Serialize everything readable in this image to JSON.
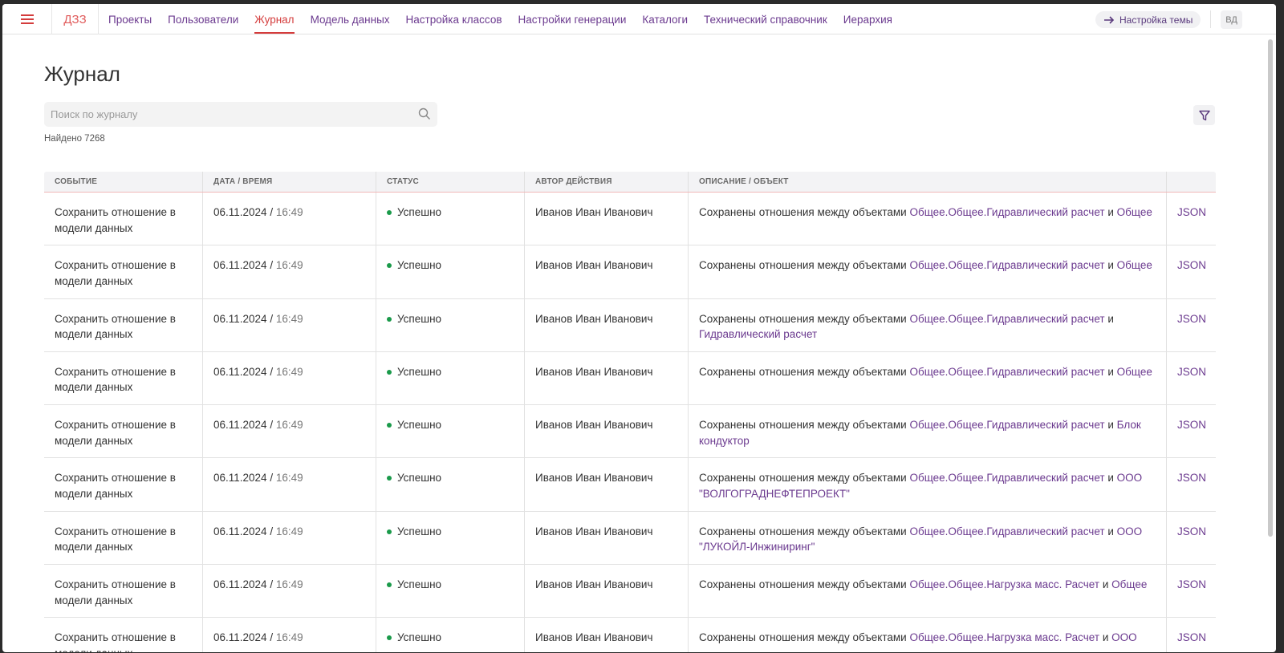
{
  "header": {
    "brand": "ДЗЗ",
    "nav": [
      {
        "label": "Проекты",
        "active": false
      },
      {
        "label": "Пользователи",
        "active": false
      },
      {
        "label": "Журнал",
        "active": true
      },
      {
        "label": "Модель данных",
        "active": false
      },
      {
        "label": "Настройка классов",
        "active": false
      },
      {
        "label": "Настройки генерации",
        "active": false
      },
      {
        "label": "Каталоги",
        "active": false
      },
      {
        "label": "Технический справочник",
        "active": false
      },
      {
        "label": "Иерархия",
        "active": false
      }
    ],
    "theme_button": "Настройка темы",
    "avatar": "ВД"
  },
  "page": {
    "title": "Журнал",
    "search_placeholder": "Поиск по журналу",
    "found": "Найдено 7268"
  },
  "table": {
    "columns": [
      "Событие",
      "Дата / время",
      "Статус",
      "Автор действия",
      "Описание / объект",
      ""
    ],
    "rows": [
      {
        "event": "Сохранить отношение в модели данных",
        "date": "06.11.2024",
        "time": "16:49",
        "status": "Успешно",
        "author": "Иванов Иван Иванович",
        "desc_prefix": "Сохранены отношения между объектами",
        "obj1": "Общее.Общее.Гидравлический расчет",
        "conj": "и",
        "obj2": "Общее",
        "action": "JSON"
      },
      {
        "event": "Сохранить отношение в модели данных",
        "date": "06.11.2024",
        "time": "16:49",
        "status": "Успешно",
        "author": "Иванов Иван Иванович",
        "desc_prefix": "Сохранены отношения между объектами",
        "obj1": "Общее.Общее.Гидравлический расчет",
        "conj": "и",
        "obj2": "Общее",
        "action": "JSON"
      },
      {
        "event": "Сохранить отношение в модели данных",
        "date": "06.11.2024",
        "time": "16:49",
        "status": "Успешно",
        "author": "Иванов Иван Иванович",
        "desc_prefix": "Сохранены отношения между объектами",
        "obj1": "Общее.Общее.Гидравлический расчет",
        "conj": "и",
        "obj2": "Гидравлический расчет",
        "action": "JSON"
      },
      {
        "event": "Сохранить отношение в модели данных",
        "date": "06.11.2024",
        "time": "16:49",
        "status": "Успешно",
        "author": "Иванов Иван Иванович",
        "desc_prefix": "Сохранены отношения между объектами",
        "obj1": "Общее.Общее.Гидравлический расчет",
        "conj": "и",
        "obj2": "Общее",
        "action": "JSON"
      },
      {
        "event": "Сохранить отношение в модели данных",
        "date": "06.11.2024",
        "time": "16:49",
        "status": "Успешно",
        "author": "Иванов Иван Иванович",
        "desc_prefix": "Сохранены отношения между объектами",
        "obj1": "Общее.Общее.Гидравлический расчет",
        "conj": "и",
        "obj2": "Блок кондуктор",
        "action": "JSON"
      },
      {
        "event": "Сохранить отношение в модели данных",
        "date": "06.11.2024",
        "time": "16:49",
        "status": "Успешно",
        "author": "Иванов Иван Иванович",
        "desc_prefix": "Сохранены отношения между объектами",
        "obj1": "Общее.Общее.Гидравлический расчет",
        "conj": "и",
        "obj2": "ООО \"ВОЛГОГРАДНЕФТЕПРОЕКТ\"",
        "action": "JSON"
      },
      {
        "event": "Сохранить отношение в модели данных",
        "date": "06.11.2024",
        "time": "16:49",
        "status": "Успешно",
        "author": "Иванов Иван Иванович",
        "desc_prefix": "Сохранены отношения между объектами",
        "obj1": "Общее.Общее.Гидравлический расчет",
        "conj": "и",
        "obj2": "ООО \"ЛУКОЙЛ-Инжиниринг\"",
        "action": "JSON"
      },
      {
        "event": "Сохранить отношение в модели данных",
        "date": "06.11.2024",
        "time": "16:49",
        "status": "Успешно",
        "author": "Иванов Иван Иванович",
        "desc_prefix": "Сохранены отношения между объектами",
        "obj1": "Общее.Общее.Нагрузка масс. Расчет",
        "conj": "и",
        "obj2": "Общее",
        "action": "JSON"
      },
      {
        "event": "Сохранить отношение в модели данных",
        "date": "06.11.2024",
        "time": "16:49",
        "status": "Успешно",
        "author": "Иванов Иван Иванович",
        "desc_prefix": "Сохранены отношения между объектами",
        "obj1": "Общее.Общее.Нагрузка масс. Расчет",
        "conj": "и",
        "obj2": "ООО",
        "action": "JSON"
      }
    ]
  },
  "icons": {
    "menu": "hamburger-icon",
    "theme": "arrow-right-icon",
    "search": "search-icon",
    "filter": "filter-icon"
  },
  "colors": {
    "accent": "#6b3a8f",
    "active": "#d43c3c",
    "success": "#1a9a4a"
  }
}
